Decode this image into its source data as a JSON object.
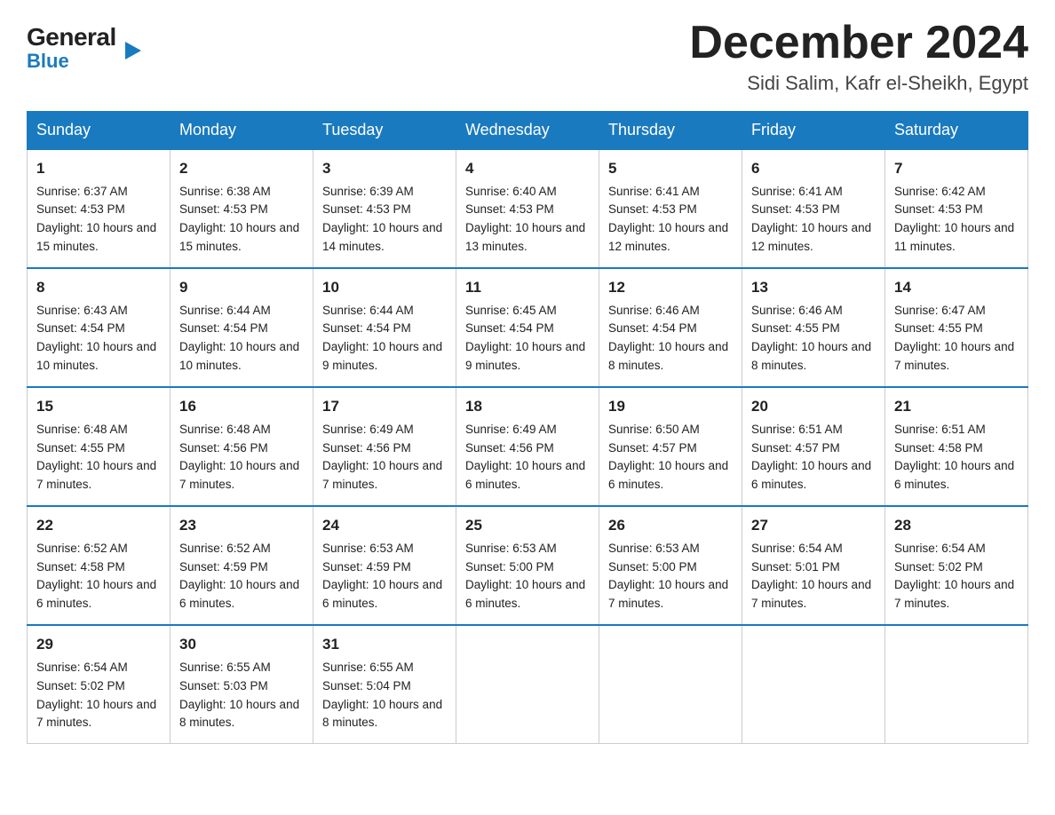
{
  "logo": {
    "general": "General",
    "triangle": "▶",
    "blue": "Blue"
  },
  "header": {
    "month": "December 2024",
    "location": "Sidi Salim, Kafr el-Sheikh, Egypt"
  },
  "days": [
    "Sunday",
    "Monday",
    "Tuesday",
    "Wednesday",
    "Thursday",
    "Friday",
    "Saturday"
  ],
  "weeks": [
    [
      {
        "num": "1",
        "sunrise": "6:37 AM",
        "sunset": "4:53 PM",
        "daylight": "10 hours and 15 minutes."
      },
      {
        "num": "2",
        "sunrise": "6:38 AM",
        "sunset": "4:53 PM",
        "daylight": "10 hours and 15 minutes."
      },
      {
        "num": "3",
        "sunrise": "6:39 AM",
        "sunset": "4:53 PM",
        "daylight": "10 hours and 14 minutes."
      },
      {
        "num": "4",
        "sunrise": "6:40 AM",
        "sunset": "4:53 PM",
        "daylight": "10 hours and 13 minutes."
      },
      {
        "num": "5",
        "sunrise": "6:41 AM",
        "sunset": "4:53 PM",
        "daylight": "10 hours and 12 minutes."
      },
      {
        "num": "6",
        "sunrise": "6:41 AM",
        "sunset": "4:53 PM",
        "daylight": "10 hours and 12 minutes."
      },
      {
        "num": "7",
        "sunrise": "6:42 AM",
        "sunset": "4:53 PM",
        "daylight": "10 hours and 11 minutes."
      }
    ],
    [
      {
        "num": "8",
        "sunrise": "6:43 AM",
        "sunset": "4:54 PM",
        "daylight": "10 hours and 10 minutes."
      },
      {
        "num": "9",
        "sunrise": "6:44 AM",
        "sunset": "4:54 PM",
        "daylight": "10 hours and 10 minutes."
      },
      {
        "num": "10",
        "sunrise": "6:44 AM",
        "sunset": "4:54 PM",
        "daylight": "10 hours and 9 minutes."
      },
      {
        "num": "11",
        "sunrise": "6:45 AM",
        "sunset": "4:54 PM",
        "daylight": "10 hours and 9 minutes."
      },
      {
        "num": "12",
        "sunrise": "6:46 AM",
        "sunset": "4:54 PM",
        "daylight": "10 hours and 8 minutes."
      },
      {
        "num": "13",
        "sunrise": "6:46 AM",
        "sunset": "4:55 PM",
        "daylight": "10 hours and 8 minutes."
      },
      {
        "num": "14",
        "sunrise": "6:47 AM",
        "sunset": "4:55 PM",
        "daylight": "10 hours and 7 minutes."
      }
    ],
    [
      {
        "num": "15",
        "sunrise": "6:48 AM",
        "sunset": "4:55 PM",
        "daylight": "10 hours and 7 minutes."
      },
      {
        "num": "16",
        "sunrise": "6:48 AM",
        "sunset": "4:56 PM",
        "daylight": "10 hours and 7 minutes."
      },
      {
        "num": "17",
        "sunrise": "6:49 AM",
        "sunset": "4:56 PM",
        "daylight": "10 hours and 7 minutes."
      },
      {
        "num": "18",
        "sunrise": "6:49 AM",
        "sunset": "4:56 PM",
        "daylight": "10 hours and 6 minutes."
      },
      {
        "num": "19",
        "sunrise": "6:50 AM",
        "sunset": "4:57 PM",
        "daylight": "10 hours and 6 minutes."
      },
      {
        "num": "20",
        "sunrise": "6:51 AM",
        "sunset": "4:57 PM",
        "daylight": "10 hours and 6 minutes."
      },
      {
        "num": "21",
        "sunrise": "6:51 AM",
        "sunset": "4:58 PM",
        "daylight": "10 hours and 6 minutes."
      }
    ],
    [
      {
        "num": "22",
        "sunrise": "6:52 AM",
        "sunset": "4:58 PM",
        "daylight": "10 hours and 6 minutes."
      },
      {
        "num": "23",
        "sunrise": "6:52 AM",
        "sunset": "4:59 PM",
        "daylight": "10 hours and 6 minutes."
      },
      {
        "num": "24",
        "sunrise": "6:53 AM",
        "sunset": "4:59 PM",
        "daylight": "10 hours and 6 minutes."
      },
      {
        "num": "25",
        "sunrise": "6:53 AM",
        "sunset": "5:00 PM",
        "daylight": "10 hours and 6 minutes."
      },
      {
        "num": "26",
        "sunrise": "6:53 AM",
        "sunset": "5:00 PM",
        "daylight": "10 hours and 7 minutes."
      },
      {
        "num": "27",
        "sunrise": "6:54 AM",
        "sunset": "5:01 PM",
        "daylight": "10 hours and 7 minutes."
      },
      {
        "num": "28",
        "sunrise": "6:54 AM",
        "sunset": "5:02 PM",
        "daylight": "10 hours and 7 minutes."
      }
    ],
    [
      {
        "num": "29",
        "sunrise": "6:54 AM",
        "sunset": "5:02 PM",
        "daylight": "10 hours and 7 minutes."
      },
      {
        "num": "30",
        "sunrise": "6:55 AM",
        "sunset": "5:03 PM",
        "daylight": "10 hours and 8 minutes."
      },
      {
        "num": "31",
        "sunrise": "6:55 AM",
        "sunset": "5:04 PM",
        "daylight": "10 hours and 8 minutes."
      },
      null,
      null,
      null,
      null
    ]
  ]
}
